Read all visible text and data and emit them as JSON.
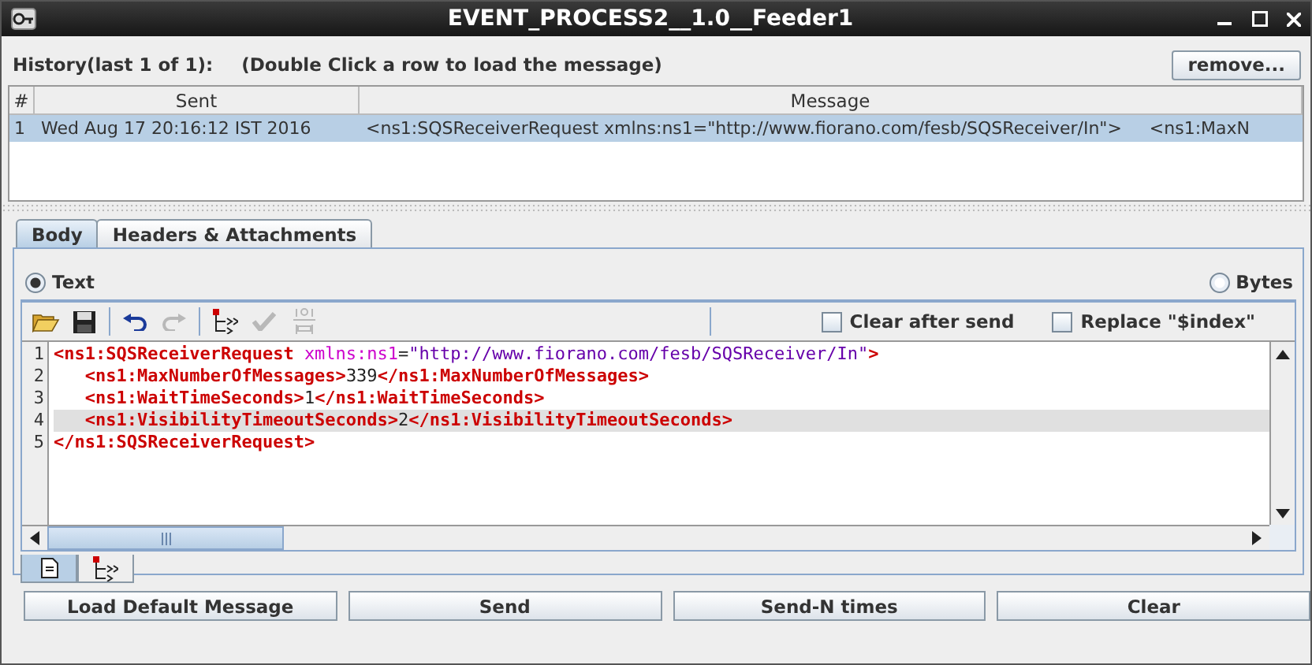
{
  "window": {
    "title": "EVENT_PROCESS2__1.0__Feeder1"
  },
  "history": {
    "label": "History(last 1 of 1):",
    "hint": "(Double Click a row to load the message)",
    "remove_button": "remove..."
  },
  "table": {
    "columns": [
      "#",
      "Sent",
      "Message"
    ],
    "rows": [
      {
        "cells": [
          "1",
          "Wed Aug 17 20:16:12 IST 2016",
          "<ns1:SQSReceiverRequest xmlns:ns1=\"http://www.fiorano.com/fesb/SQSReceiver/In\">     <ns1:MaxN"
        ],
        "selected": true
      }
    ]
  },
  "tabs": [
    {
      "label": "Body",
      "selected": true
    },
    {
      "label": "Headers & Attachments",
      "selected": false
    }
  ],
  "format_radios": [
    {
      "label": "Text",
      "selected": true
    },
    {
      "label": "Bytes",
      "selected": false
    }
  ],
  "toolbar": [
    {
      "kind": "open",
      "disabled": false
    },
    {
      "kind": "save",
      "disabled": false
    },
    {
      "kind": "separator"
    },
    {
      "kind": "undo",
      "disabled": false
    },
    {
      "kind": "redo",
      "disabled": true
    },
    {
      "kind": "separator"
    },
    {
      "kind": "tree",
      "disabled": false
    },
    {
      "kind": "check",
      "disabled": true
    },
    {
      "kind": "xml",
      "disabled": true
    }
  ],
  "options": [
    {
      "label": "Clear after send",
      "checked": false
    },
    {
      "label": "Replace \"$index\"",
      "checked": false
    }
  ],
  "editor": {
    "lines": [
      {
        "number": "1",
        "current": false,
        "indented": false,
        "segments": [
          {
            "kind": "tag",
            "text": "<ns1:SQSReceiverRequest"
          },
          {
            "kind": "attr",
            "text": "xmlns:ns1"
          },
          {
            "kind": "text",
            "text": "="
          },
          {
            "kind": "value",
            "text": "\"http://www.fiorano.com/fesb/SQSReceiver/In\""
          },
          {
            "kind": "tag",
            "text": ">"
          }
        ]
      },
      {
        "number": "2",
        "current": false,
        "indented": true,
        "segments": [
          {
            "kind": "tag",
            "text": "<ns1:MaxNumberOfMessages>"
          },
          {
            "kind": "text",
            "text": "339"
          },
          {
            "kind": "tag",
            "text": "</ns1:MaxNumberOfMessages>"
          }
        ]
      },
      {
        "number": "3",
        "current": false,
        "indented": true,
        "segments": [
          {
            "kind": "tag",
            "text": "<ns1:WaitTimeSeconds>"
          },
          {
            "kind": "text",
            "text": "1"
          },
          {
            "kind": "tag",
            "text": "</ns1:WaitTimeSeconds>"
          }
        ]
      },
      {
        "number": "4",
        "current": true,
        "indented": true,
        "segments": [
          {
            "kind": "tag",
            "text": "<ns1:VisibilityTimeoutSeconds>"
          },
          {
            "kind": "text",
            "text": "2"
          },
          {
            "kind": "tag",
            "text": "</ns1:VisibilityTimeoutSeconds>"
          }
        ]
      },
      {
        "number": "5",
        "current": false,
        "indented": false,
        "segments": [
          {
            "kind": "tag",
            "text": "</ns1:SQSReceiverRequest>"
          }
        ]
      }
    ]
  },
  "view_tabs": [
    {
      "kind": "text",
      "selected": true
    },
    {
      "kind": "tree",
      "selected": false
    }
  ],
  "buttons": [
    "Load Default Message",
    "Send",
    "Send-N times",
    "Clear"
  ]
}
